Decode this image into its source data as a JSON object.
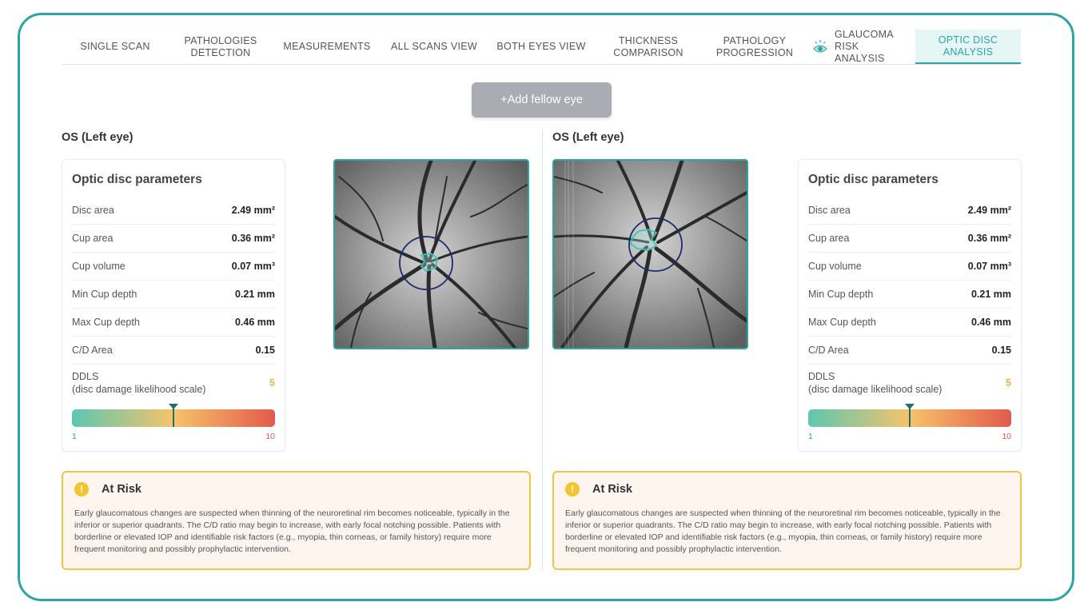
{
  "tabs": [
    {
      "label": "SINGLE SCAN"
    },
    {
      "label": "PATHOLOGIES DETECTION"
    },
    {
      "label": "MEASUREMENTS"
    },
    {
      "label": "ALL SCANS VIEW"
    },
    {
      "label": "BOTH EYES VIEW"
    },
    {
      "label": "THICKNESS COMPARISON"
    },
    {
      "label": "PATHOLOGY PROGRESSION"
    },
    {
      "label": "GLAUCOMA RISK ANALYSIS",
      "icon": "eye-icon"
    },
    {
      "label": "OPTIC DISC ANALYSIS",
      "active": true
    }
  ],
  "add_fellow_eye": "+Add fellow eye",
  "left_panel": {
    "eye_title": "OS (Left eye)",
    "params_title": "Optic disc parameters",
    "rows": [
      {
        "label": "Disc area",
        "value": "2.49 mm²"
      },
      {
        "label": "Cup area",
        "value": "0.36 mm²"
      },
      {
        "label": "Cup volume",
        "value": "0.07 mm³"
      },
      {
        "label": "Min Cup depth",
        "value": "0.21 mm"
      },
      {
        "label": "Max Cup depth",
        "value": "0.46 mm"
      },
      {
        "label": "C/D Area",
        "value": "0.15"
      }
    ],
    "ddls_label": "DDLS",
    "ddls_sub": "(disc damage likelihood scale)",
    "ddls_value": "5",
    "ddls_position": 0.5,
    "scale_min": "1",
    "scale_max": "10",
    "risk_title": "At Risk",
    "risk_text": "Early glaucomatous changes are suspected when thinning of the neuroretinal rim becomes noticeable, typically in the inferior or superior quadrants. The C/D ratio may begin to increase, with early focal notching possible. Patients with borderline or elevated IOP and identifiable risk factors (e.g., myopia, thin corneas, or family history) require more frequent monitoring and possibly prophylactic intervention."
  },
  "right_panel": {
    "eye_title": "OS (Left eye)",
    "params_title": "Optic disc parameters",
    "rows": [
      {
        "label": "Disc area",
        "value": "2.49 mm²"
      },
      {
        "label": "Cup area",
        "value": "0.36 mm²"
      },
      {
        "label": "Cup volume",
        "value": "0.07 mm³"
      },
      {
        "label": "Min Cup depth",
        "value": "0.21 mm"
      },
      {
        "label": "Max Cup depth",
        "value": "0.46 mm"
      },
      {
        "label": "C/D Area",
        "value": "0.15"
      }
    ],
    "ddls_label": "DDLS",
    "ddls_sub": "(disc damage likelihood scale)",
    "ddls_value": "5",
    "ddls_position": 0.5,
    "scale_min": "1",
    "scale_max": "10",
    "risk_title": "At Risk",
    "risk_text": "Early glaucomatous changes are suspected when thinning of the neuroretinal rim becomes noticeable, typically in the inferior or superior quadrants. The C/D ratio may begin to increase, with early focal notching possible. Patients with borderline or elevated IOP and identifiable risk factors (e.g., myopia, thin corneas, or family history) require more frequent monitoring and possibly prophylactic intervention."
  },
  "colors": {
    "accent": "#2aa7a2",
    "warning": "#f4c431",
    "risk_border": "#f0c64a",
    "risk_bg": "#fdf5ee",
    "disc_circle": "#1e2a6e",
    "cup_outline": "#3cc4b6"
  }
}
